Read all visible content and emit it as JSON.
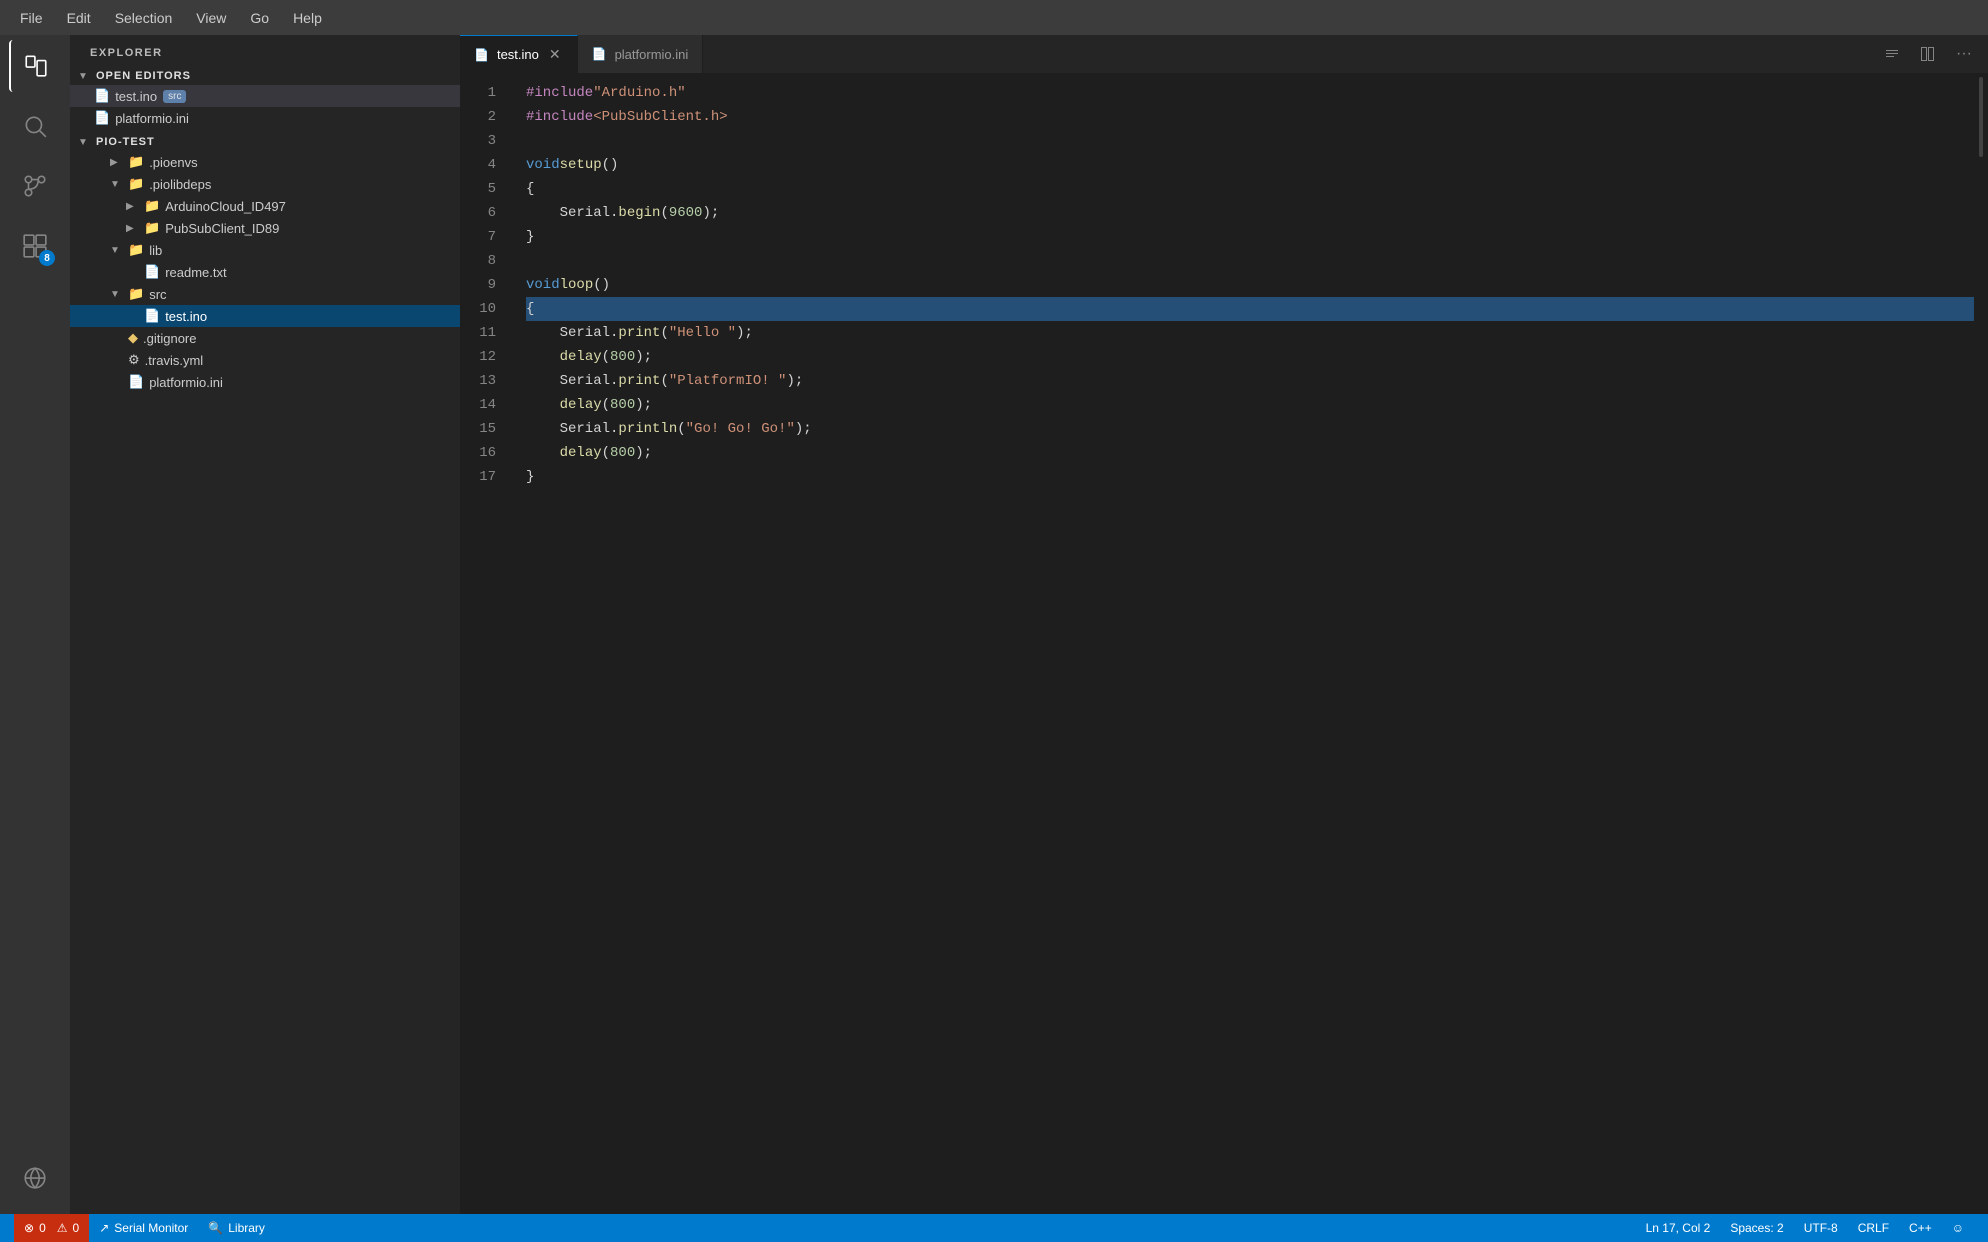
{
  "menu": {
    "items": [
      "File",
      "Edit",
      "Selection",
      "View",
      "Go",
      "Help"
    ]
  },
  "activity_bar": {
    "icons": [
      {
        "name": "explorer-icon",
        "symbol": "📄",
        "active": true,
        "badge": null
      },
      {
        "name": "search-icon",
        "symbol": "🔍",
        "active": false,
        "badge": null
      },
      {
        "name": "source-control-icon",
        "symbol": "⑂",
        "active": false,
        "badge": null
      },
      {
        "name": "extensions-icon",
        "symbol": "⊞",
        "active": false,
        "badge": "8"
      }
    ]
  },
  "sidebar": {
    "header": "EXPLORER",
    "sections": {
      "open_editors": {
        "label": "OPEN EDITORS",
        "expanded": true,
        "items": [
          {
            "name": "test.ino",
            "tag": "src",
            "active": true
          },
          {
            "name": "platformio.ini",
            "tag": null,
            "active": false
          }
        ]
      },
      "pio_test": {
        "label": "PIO-TEST",
        "expanded": true,
        "folders": [
          {
            "name": ".pioenvs",
            "expanded": false,
            "indent": 2,
            "children": []
          },
          {
            "name": ".piolibdeps",
            "expanded": true,
            "indent": 2,
            "children": [
              {
                "name": "ArduinoCloud_ID497",
                "indent": 3,
                "type": "folder"
              },
              {
                "name": "PubSubClient_ID89",
                "indent": 3,
                "type": "folder"
              }
            ]
          },
          {
            "name": "lib",
            "expanded": true,
            "indent": 2,
            "children": [
              {
                "name": "readme.txt",
                "indent": 3,
                "type": "file"
              }
            ]
          },
          {
            "name": "src",
            "expanded": true,
            "indent": 2,
            "children": [
              {
                "name": "test.ino",
                "indent": 3,
                "type": "file",
                "selected": true
              }
            ]
          }
        ],
        "files": [
          {
            "name": ".gitignore",
            "type": "diamond"
          },
          {
            "name": ".travis.yml",
            "type": "gear"
          },
          {
            "name": "platformio.ini",
            "type": "file"
          }
        ]
      }
    }
  },
  "tabs": [
    {
      "label": "test.ino",
      "active": true,
      "closable": true
    },
    {
      "label": "platformio.ini",
      "active": false,
      "closable": false
    }
  ],
  "code": {
    "lines": [
      {
        "num": 1,
        "content": "#include \"Arduino.h\"",
        "tokens": [
          {
            "text": "#include",
            "cls": "inc"
          },
          {
            "text": " ",
            "cls": ""
          },
          {
            "text": "\"Arduino.h\"",
            "cls": "str"
          }
        ]
      },
      {
        "num": 2,
        "content": "#include <PubSubClient.h>",
        "tokens": [
          {
            "text": "#include",
            "cls": "inc"
          },
          {
            "text": " <PubSubClient.h>",
            "cls": "str"
          }
        ]
      },
      {
        "num": 3,
        "content": "",
        "tokens": []
      },
      {
        "num": 4,
        "content": "void setup()",
        "tokens": [
          {
            "text": "void",
            "cls": "kw"
          },
          {
            "text": " ",
            "cls": ""
          },
          {
            "text": "setup",
            "cls": "fn"
          },
          {
            "text": "()",
            "cls": "punc"
          }
        ]
      },
      {
        "num": 5,
        "content": "{",
        "tokens": [
          {
            "text": "{",
            "cls": "punc"
          }
        ]
      },
      {
        "num": 6,
        "content": "    Serial.begin(9600);",
        "tokens": [
          {
            "text": "    Serial.",
            "cls": ""
          },
          {
            "text": "begin",
            "cls": "fn"
          },
          {
            "text": "(",
            "cls": "punc"
          },
          {
            "text": "9600",
            "cls": "num"
          },
          {
            "text": ");",
            "cls": "punc"
          }
        ]
      },
      {
        "num": 7,
        "content": "}",
        "tokens": [
          {
            "text": "}",
            "cls": "punc"
          }
        ]
      },
      {
        "num": 8,
        "content": "",
        "tokens": []
      },
      {
        "num": 9,
        "content": "void loop()",
        "tokens": [
          {
            "text": "void",
            "cls": "kw"
          },
          {
            "text": " ",
            "cls": ""
          },
          {
            "text": "loop",
            "cls": "fn"
          },
          {
            "text": "()",
            "cls": "punc"
          }
        ]
      },
      {
        "num": 10,
        "content": "{",
        "tokens": [
          {
            "text": "{",
            "cls": "punc"
          }
        ],
        "highlight": true
      },
      {
        "num": 11,
        "content": "    Serial.print(\"Hello \");",
        "tokens": [
          {
            "text": "    Serial.",
            "cls": ""
          },
          {
            "text": "print",
            "cls": "fn"
          },
          {
            "text": "(",
            "cls": "punc"
          },
          {
            "text": "\"Hello \"",
            "cls": "str"
          },
          {
            "text": ");",
            "cls": "punc"
          }
        ]
      },
      {
        "num": 12,
        "content": "    delay(800);",
        "tokens": [
          {
            "text": "    ",
            "cls": ""
          },
          {
            "text": "delay",
            "cls": "fn"
          },
          {
            "text": "(",
            "cls": "punc"
          },
          {
            "text": "800",
            "cls": "num"
          },
          {
            "text": ");",
            "cls": "punc"
          }
        ]
      },
      {
        "num": 13,
        "content": "    Serial.print(\"PlatformIO! \");",
        "tokens": [
          {
            "text": "    Serial.",
            "cls": ""
          },
          {
            "text": "print",
            "cls": "fn"
          },
          {
            "text": "(",
            "cls": "punc"
          },
          {
            "text": "\"PlatformIO! \"",
            "cls": "str"
          },
          {
            "text": ");",
            "cls": "punc"
          }
        ]
      },
      {
        "num": 14,
        "content": "    delay(800);",
        "tokens": [
          {
            "text": "    ",
            "cls": ""
          },
          {
            "text": "delay",
            "cls": "fn"
          },
          {
            "text": "(",
            "cls": "punc"
          },
          {
            "text": "800",
            "cls": "num"
          },
          {
            "text": ");",
            "cls": "punc"
          }
        ]
      },
      {
        "num": 15,
        "content": "    Serial.println(\"Go! Go! Go!\");",
        "tokens": [
          {
            "text": "    Serial.",
            "cls": ""
          },
          {
            "text": "println",
            "cls": "fn"
          },
          {
            "text": "(",
            "cls": "punc"
          },
          {
            "text": "\"Go! Go! Go!\"",
            "cls": "str"
          },
          {
            "text": ");",
            "cls": "punc"
          }
        ]
      },
      {
        "num": 16,
        "content": "    delay(800);",
        "tokens": [
          {
            "text": "    ",
            "cls": ""
          },
          {
            "text": "delay",
            "cls": "fn"
          },
          {
            "text": "(",
            "cls": "punc"
          },
          {
            "text": "800",
            "cls": "num"
          },
          {
            "text": ");",
            "cls": "punc"
          }
        ]
      },
      {
        "num": 17,
        "content": "}",
        "tokens": [
          {
            "text": "}",
            "cls": "punc"
          }
        ]
      }
    ]
  },
  "status_bar": {
    "errors": "⊗ 0",
    "warnings": "⚠ 0",
    "serial_monitor": "Serial Monitor",
    "library": "Library",
    "position": "Ln 17, Col 2",
    "spaces": "Spaces: 2",
    "encoding": "UTF-8",
    "line_ending": "CRLF",
    "language": "C++",
    "smiley": "☺"
  }
}
